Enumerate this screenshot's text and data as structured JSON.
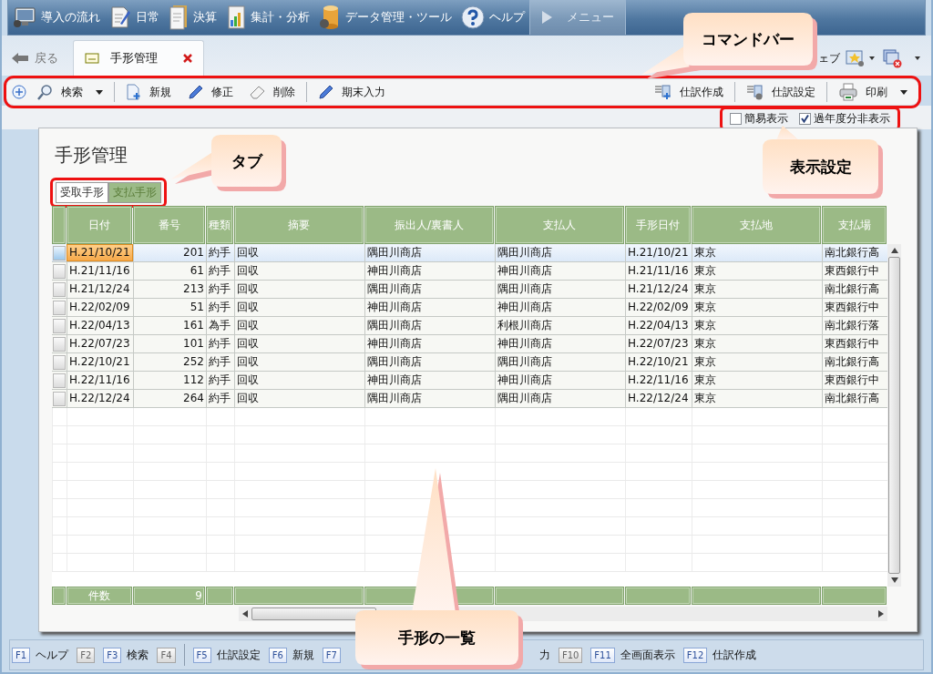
{
  "menu": [
    {
      "label": "導入の流れ",
      "selected": false
    },
    {
      "label": "日常",
      "selected": false
    },
    {
      "label": "決算",
      "selected": false
    },
    {
      "label": "集計・分析",
      "selected": false
    },
    {
      "label": "データ管理・ツール",
      "selected": false
    },
    {
      "label": "ヘルプ",
      "selected": false
    },
    {
      "label": "メニュー",
      "selected": true
    }
  ],
  "nav": {
    "back": "戻る",
    "doc_tab": "手形管理",
    "right_text": "ェブ"
  },
  "commands_left": [
    {
      "label": "検索"
    },
    {
      "label": "新規"
    },
    {
      "label": "修正"
    },
    {
      "label": "削除"
    },
    {
      "label": "期末入力"
    }
  ],
  "commands_right": [
    {
      "label": "仕訳作成"
    },
    {
      "label": "仕訳設定"
    },
    {
      "label": "印刷"
    }
  ],
  "options": [
    {
      "label": "簡易表示",
      "checked": false
    },
    {
      "label": "過年度分非表示",
      "checked": true
    }
  ],
  "page_title": "手形管理",
  "tabs": [
    {
      "label": "受取手形",
      "selected": true
    },
    {
      "label": "支払手形",
      "selected": false
    }
  ],
  "table": {
    "columns": [
      "日付",
      "番号",
      "種類",
      "摘要",
      "振出人/裏書人",
      "支払人",
      "手形日付",
      "支払地",
      "支払場"
    ],
    "rows": [
      {
        "selected": true,
        "cells": [
          "H.21/10/21",
          "201",
          "約手",
          "回収",
          "隅田川商店",
          "隅田川商店",
          "H.21/10/21",
          "東京",
          "南北銀行高"
        ]
      },
      {
        "selected": false,
        "cells": [
          "H.21/11/16",
          "61",
          "約手",
          "回収",
          "神田川商店",
          "神田川商店",
          "H.21/11/16",
          "東京",
          "東西銀行中"
        ]
      },
      {
        "selected": false,
        "cells": [
          "H.21/12/24",
          "213",
          "約手",
          "回収",
          "隅田川商店",
          "隅田川商店",
          "H.21/12/24",
          "東京",
          "南北銀行高"
        ]
      },
      {
        "selected": false,
        "cells": [
          "H.22/02/09",
          "51",
          "約手",
          "回収",
          "神田川商店",
          "神田川商店",
          "H.22/02/09",
          "東京",
          "東西銀行中"
        ]
      },
      {
        "selected": false,
        "cells": [
          "H.22/04/13",
          "161",
          "為手",
          "回収",
          "隅田川商店",
          "利根川商店",
          "H.22/04/13",
          "東京",
          "南北銀行落"
        ]
      },
      {
        "selected": false,
        "cells": [
          "H.22/07/23",
          "101",
          "約手",
          "回収",
          "神田川商店",
          "神田川商店",
          "H.22/07/23",
          "東京",
          "東西銀行中"
        ]
      },
      {
        "selected": false,
        "cells": [
          "H.22/10/21",
          "252",
          "約手",
          "回収",
          "隅田川商店",
          "隅田川商店",
          "H.22/10/21",
          "東京",
          "南北銀行高"
        ]
      },
      {
        "selected": false,
        "cells": [
          "H.22/11/16",
          "112",
          "約手",
          "回収",
          "神田川商店",
          "神田川商店",
          "H.22/11/16",
          "東京",
          "東西銀行中"
        ]
      },
      {
        "selected": false,
        "cells": [
          "H.22/12/24",
          "264",
          "約手",
          "回収",
          "隅田川商店",
          "隅田川商店",
          "H.22/12/24",
          "東京",
          "南北銀行高"
        ]
      }
    ],
    "footer": {
      "label": "件数",
      "count": "9"
    }
  },
  "fkeys": [
    {
      "key": "F1",
      "label": "ヘルプ",
      "disabled": false
    },
    {
      "key": "F2",
      "disabled": true
    },
    {
      "key": "F3",
      "label": "検索",
      "disabled": false
    },
    {
      "key": "F4",
      "disabled": true
    },
    {
      "key": "F5",
      "label": "仕訳設定",
      "disabled": false
    },
    {
      "key": "F6",
      "label": "新規",
      "disabled": false
    },
    {
      "key": "F7",
      "disabled": false
    },
    {
      "label": "力"
    },
    {
      "key": "F10",
      "disabled": true
    },
    {
      "key": "F11",
      "label": "全画面表示",
      "disabled": false
    },
    {
      "key": "F12",
      "label": "仕訳作成",
      "disabled": false
    }
  ],
  "callouts": [
    {
      "text": "コマンドバー"
    },
    {
      "text": "タブ"
    },
    {
      "text": "表示設定"
    },
    {
      "text": "手形の一覧"
    }
  ]
}
